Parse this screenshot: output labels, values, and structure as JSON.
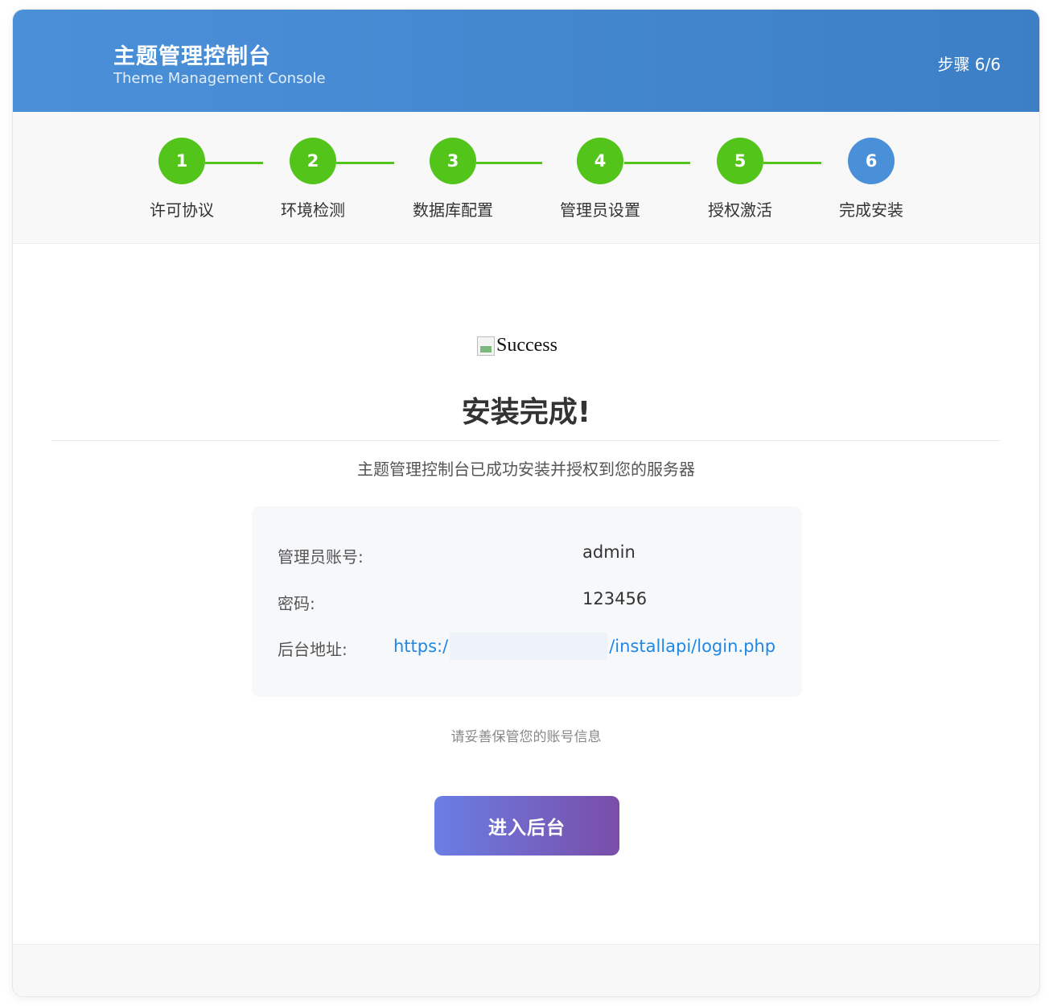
{
  "header": {
    "title": "主题管理控制台",
    "subtitle": "Theme Management Console",
    "step_indicator": "步骤 6/6"
  },
  "steps": [
    {
      "number": "1",
      "label": "许可协议",
      "status": "completed"
    },
    {
      "number": "2",
      "label": "环境检测",
      "status": "completed"
    },
    {
      "number": "3",
      "label": "数据库配置",
      "status": "completed"
    },
    {
      "number": "4",
      "label": "管理员设置",
      "status": "completed"
    },
    {
      "number": "5",
      "label": "授权激活",
      "status": "completed"
    },
    {
      "number": "6",
      "label": "完成安装",
      "status": "current"
    }
  ],
  "content": {
    "image_alt": "Success",
    "title": "安装完成!",
    "description": "主题管理控制台已成功安装并授权到您的服务器",
    "info": {
      "admin_label": "管理员账号:",
      "admin_value": "admin",
      "password_label": "密码:",
      "password_value": "123456",
      "url_label": "后台地址:",
      "url_prefix": "https:/",
      "url_suffix": "/installapi/login.php"
    },
    "notice": "请妥善保管您的账号信息",
    "enter_button": "进入后台"
  },
  "colors": {
    "header": "#4a90d9",
    "step_completed": "#52c41a",
    "step_current": "#4a90d9",
    "link": "#1e88e5",
    "button_start": "#6a7ee4",
    "button_end": "#7a4da8"
  }
}
